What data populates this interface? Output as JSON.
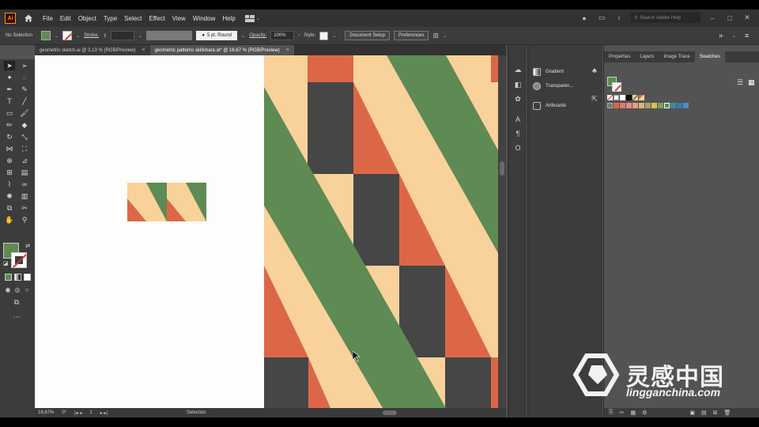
{
  "menubar": {
    "app_logo": "Ai",
    "items": [
      "File",
      "Edit",
      "Object",
      "Type",
      "Select",
      "Effect",
      "View",
      "Window",
      "Help"
    ],
    "search_placeholder": "Search Adobe Help"
  },
  "controlbar": {
    "selection_label": "No Selection",
    "stroke_label": "Stroke:",
    "stroke_preset": "5 pt. Round",
    "opacity_label": "Opacity:",
    "opacity_value": "100%",
    "style_label": "Style:",
    "document_setup": "Document Setup",
    "preferences": "Preferences"
  },
  "tabs": [
    {
      "label": "geometric sketch.ai @ 3,13 % (RGB/Preview)",
      "close": "×"
    },
    {
      "label": "geometric patterns skillshare.ai* @ 16,67 % (RGB/Preview)",
      "close": "×"
    }
  ],
  "statusbar": {
    "zoom": "16,67%",
    "rotation": "0°",
    "artboard": "1",
    "tool": "Selection"
  },
  "collapsed_panels": {
    "gradient": "Gradient",
    "transparency": "Transparen...",
    "artboards": "Artboards"
  },
  "swatches_panel": {
    "tabs": [
      "Properties",
      "Layers",
      "Image Trace",
      "Swatches"
    ],
    "active_tab": "Swatches"
  },
  "colors": {
    "green": "#5e8a54",
    "peach": "#f8d29a",
    "orange": "#dc6747",
    "dark": "#464646"
  },
  "watermark": {
    "title": "灵感中国",
    "url": "lingganchina.com"
  }
}
